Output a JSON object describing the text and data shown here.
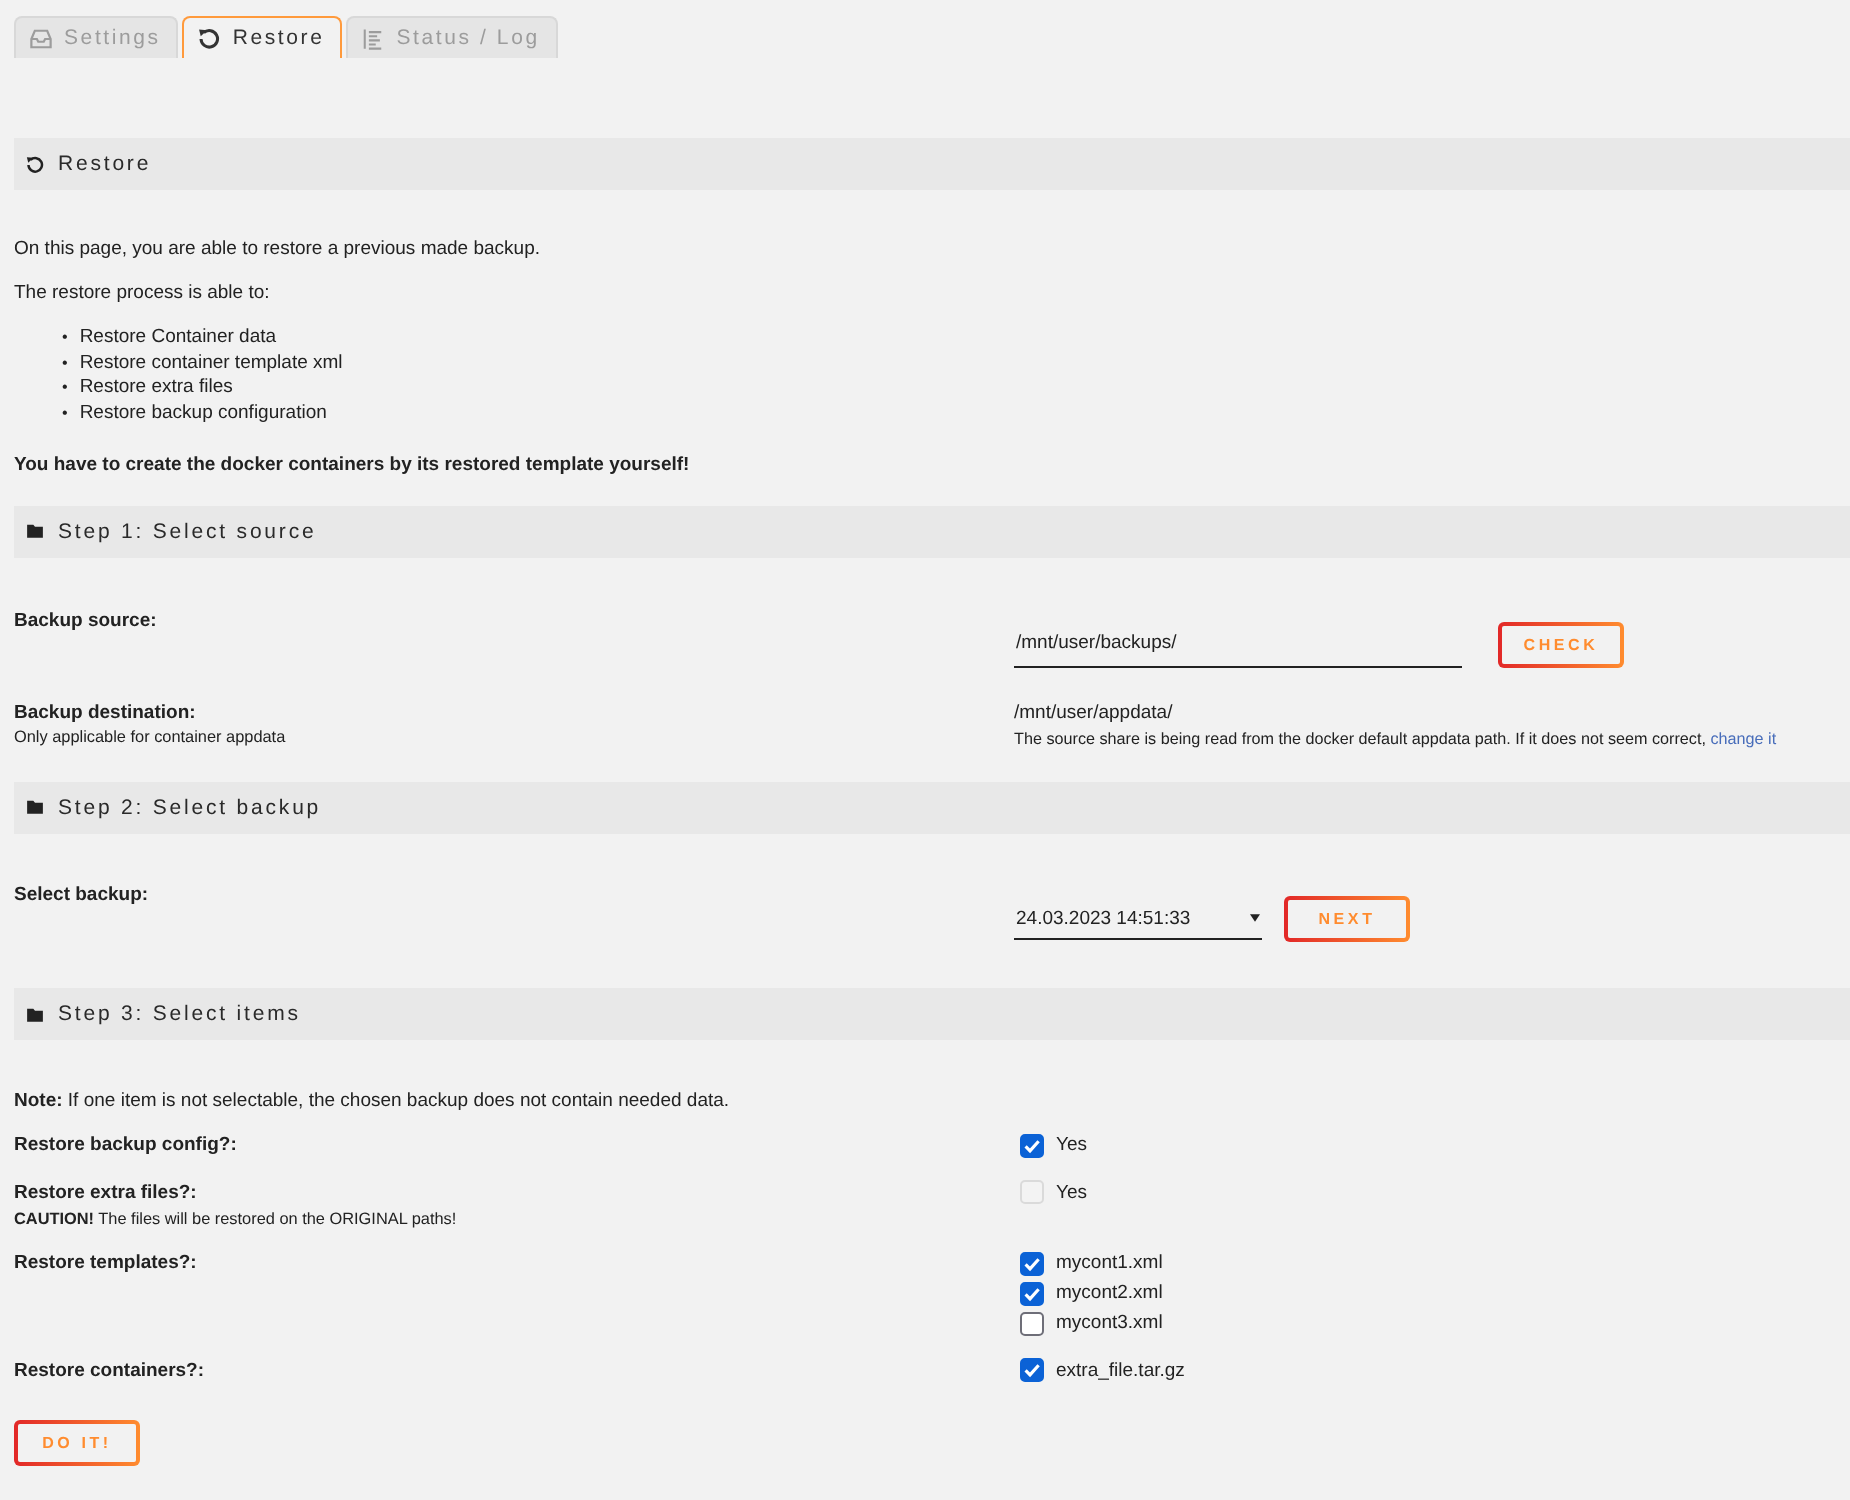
{
  "tabs": [
    {
      "label": "Settings",
      "selected": false
    },
    {
      "label": "Restore",
      "selected": true
    },
    {
      "label": "Status / Log",
      "selected": false
    }
  ],
  "header": {
    "title": "Restore"
  },
  "intro": {
    "text": "On this page, you are able to restore a previous made backup.",
    "list_title": "The restore process is able to:",
    "items": [
      {
        "bullet": "•",
        "text": "Restore Container data"
      },
      {
        "bullet": "•",
        "text": "Restore container template xml"
      },
      {
        "bullet": "•",
        "text": "Restore extra files"
      },
      {
        "bullet": "•",
        "text": "Restore backup configuration"
      }
    ],
    "warning": "You have to create the docker containers by its restored template yourself!"
  },
  "step_1": {
    "title": "Step 1: Select source",
    "backup_source": {
      "label": "Backup source:",
      "value": "/mnt/user/backups/",
      "button": "CHECK"
    },
    "backup_destination": {
      "label": "Backup destination:",
      "hint": "Only applicable for container appdata",
      "value": "/mnt/user/appdata/",
      "note": "The source share is being read from the docker default appdata path. If it does not seem correct,",
      "link": "change it"
    }
  },
  "step_2": {
    "title": "Step 2: Select backup",
    "select_backup": {
      "label": "Select backup:",
      "value": "24.03.2023 14:51:33",
      "button": "NEXT"
    }
  },
  "step_3": {
    "title": "Step 3: Select items",
    "note": "**Note:** If one item is not selectable, the chosen backup does not contain needed data.",
    "rows": [
      {
        "label": "Restore backup config?:",
        "options": [
          {
            "label": "Yes",
            "checked": true,
            "disabled": false
          }
        ]
      },
      {
        "label": "Restore extra files?:",
        "hint": "**CAUTION!** The files will be restored on the ORIGINAL paths!",
        "options": [
          {
            "label": "Yes",
            "checked": false,
            "disabled": true
          }
        ]
      },
      {
        "label": "Restore templates?:",
        "options": [
          {
            "label": "mycont1.xml",
            "checked": true,
            "disabled": false
          },
          {
            "label": "mycont2.xml",
            "checked": true,
            "disabled": false
          },
          {
            "label": "mycont3.xml",
            "checked": false,
            "disabled": false
          }
        ]
      },
      {
        "label": "Restore containers?:",
        "options": [
          {
            "label": "extra_file.tar.gz",
            "checked": true,
            "disabled": false
          }
        ]
      }
    ]
  },
  "submit_button": "DO IT!"
}
